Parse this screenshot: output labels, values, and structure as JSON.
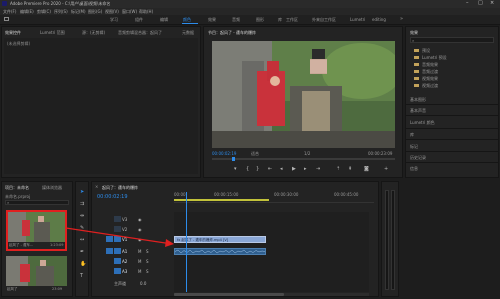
{
  "app": {
    "title": "Adobe Premiere Pro 2020 - C:\\用户\\桌面\\视频\\未命名",
    "menu": [
      "文件(F)",
      "编辑(E)",
      "剪辑(C)",
      "序列(S)",
      "标记(M)",
      "图形(G)",
      "视图(V)",
      "窗口(W)",
      "帮助(H)"
    ]
  },
  "workspaces": {
    "tabs": [
      "学习",
      "组件",
      "编辑",
      "颜色",
      "效果",
      "音频",
      "图形",
      "库",
      "工作区",
      "外来自工作区",
      "Lumetri",
      "editing"
    ],
    "active": "编辑"
  },
  "source_panel": {
    "tabs": [
      "效果控件",
      "Lumetri 范围",
      "源：(无剪辑)",
      "音频剪辑混合器：起风了",
      "元数据"
    ],
    "placeholder": "(未选择剪辑)"
  },
  "program": {
    "tab": "节目：起风了 - 遭车的爆炸",
    "timecode_left": "00:00:02:19",
    "fit": "适合",
    "quality": "1/2",
    "timecode_right": "00:00:23:09"
  },
  "effects_panel": {
    "title": "效果",
    "items": [
      "预设",
      "Lumetri 预设",
      "音频效果",
      "音频过渡",
      "视频效果",
      "视频过渡"
    ],
    "sections": [
      "基本图形",
      "基本声音",
      "Lumetri 颜色",
      "库",
      "标记",
      "历史记录",
      "信息"
    ]
  },
  "project": {
    "tabs": [
      "项目：未命名",
      "媒体浏览器"
    ],
    "file": "未命名.prproj",
    "clip1_label": "起风了 - 遭车...",
    "clip1_duration": "1:23:09",
    "clip2_label": "起风了",
    "clip2_duration": "23:09"
  },
  "timeline": {
    "tab": "起风了：遭车的爆炸",
    "timecode": "00:00:02:19",
    "ruler": [
      "00:00",
      "00:00:15:00",
      "00:00:30:00",
      "00:00:45:00"
    ],
    "video_tracks": [
      "V3",
      "V2",
      "V1"
    ],
    "audio_tracks": [
      "A1",
      "A2",
      "A3"
    ],
    "master": "主声道",
    "master_value": "0.0",
    "clip_label": "fx 起风了 - 遭车的爆炸.mp4 [V]"
  },
  "tools": [
    "selection",
    "track-select",
    "ripple",
    "razor",
    "slip",
    "pen",
    "hand",
    "type"
  ],
  "colors": {
    "accent": "#2d8ceb",
    "annotation": "#e02020",
    "clip_video": "#8aa7d6",
    "clip_audio": "#2f5f8f"
  }
}
